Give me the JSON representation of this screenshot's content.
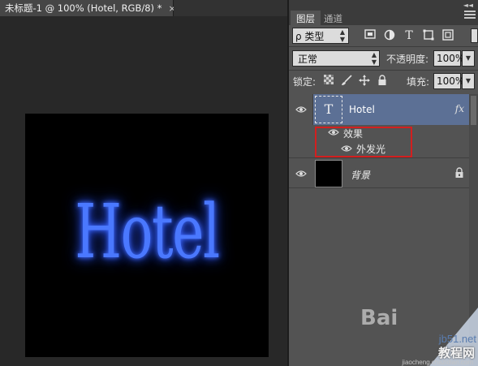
{
  "document": {
    "tab_title": "未标题-1 @ 100% (Hotel, RGB/8) *",
    "close_glyph": "×",
    "canvas_text": "Hotel",
    "glow_color": "#3f6bff"
  },
  "panel": {
    "tabs": [
      {
        "label": "图层",
        "active": true
      },
      {
        "label": "通道",
        "active": false
      }
    ],
    "filter": {
      "label": "ρ 类型",
      "icons": [
        "image-filter-icon",
        "adjustment-filter-icon",
        "type-filter-icon",
        "shape-filter-icon",
        "smart-object-filter-icon"
      ]
    },
    "blend_mode": "正常",
    "opacity_label": "不透明度:",
    "opacity_value": "100%",
    "lock_label": "锁定:",
    "lock_icons": [
      "lock-transparent-icon",
      "lock-paint-icon",
      "lock-position-icon",
      "lock-all-icon"
    ],
    "fill_label": "填充:",
    "fill_value": "100%"
  },
  "layers": [
    {
      "name": "Hotel",
      "type": "text",
      "thumb_glyph": "T",
      "fx": "fx",
      "selected": true
    },
    {
      "effects_label": "效果",
      "effect": "外发光"
    },
    {
      "name": "背景",
      "type": "background",
      "locked": true
    }
  ],
  "highlight_color": "#d31f1f",
  "selection_color": "#5c7095",
  "watermark": {
    "bai": "Bai",
    "site": "jb51.net",
    "brand": "教程网",
    "url": "jiaocheng.chazidian.com"
  }
}
